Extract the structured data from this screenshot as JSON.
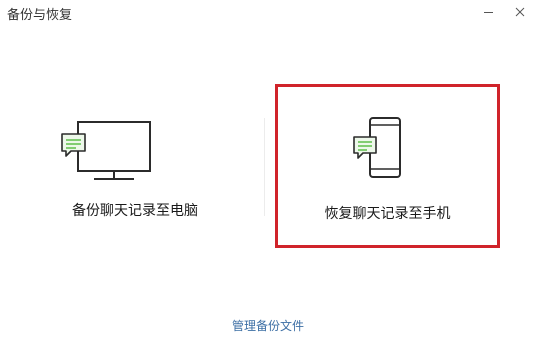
{
  "window": {
    "title": "备份与恢复",
    "controls": {
      "minimize_icon": "minimize-icon",
      "close_icon": "close-icon"
    }
  },
  "options": {
    "backup_to_pc": {
      "label": "备份聊天记录至电脑",
      "icon": "monitor-chat-icon"
    },
    "restore_to_phone": {
      "label": "恢复聊天记录至手机",
      "icon": "phone-chat-icon",
      "highlighted": true
    }
  },
  "footer": {
    "manage_link": "管理备份文件"
  },
  "colors": {
    "highlight_border": "#d0232a",
    "link": "#3d6fa5",
    "chat_bubble_fill": "#edf8ea",
    "chat_bubble_lines": "#5fbf4a",
    "icon_stroke": "#2b2b2b"
  }
}
